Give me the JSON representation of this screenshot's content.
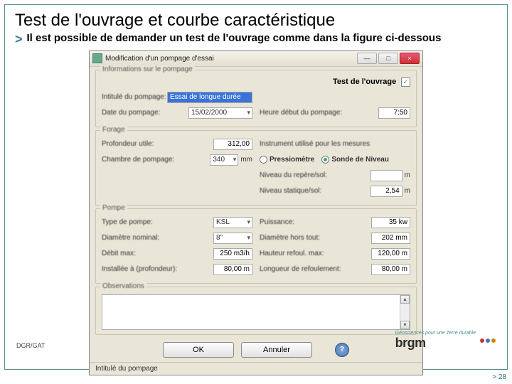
{
  "slide": {
    "title": "Test de l'ouvrage et courbe caractéristique",
    "bullet": "Il est possible de demander un test de l'ouvrage comme dans la figure ci-dessous",
    "footer_left": "DGR/GAT",
    "brgm_tag": "Géosciences pour une Terre durable",
    "brgm_name": "brgm",
    "pagenum": "> 28"
  },
  "dlg": {
    "title": "Modification d'un pompage d'essai",
    "win_min": "—",
    "win_max": "□",
    "win_close": "×",
    "grp_info": "Informations sur le pompage",
    "test_label": "Test de l'ouvrage",
    "test_check": "✓",
    "lbl_intitule": "Intitulé du pompage:",
    "val_intitule": "Essai de longue durée",
    "lbl_date": "Date du pompage:",
    "val_date": "15/02/2000",
    "lbl_heure": "Heure début du pompage:",
    "val_heure": "7:50",
    "grp_forage": "Forage",
    "lbl_prof": "Profondeur utile:",
    "val_prof": "312,00",
    "lbl_cham": "Chambre de pompage:",
    "val_cham": "340",
    "unit_mm": "mm",
    "lbl_instr": "Instrument utilisé pour les mesures",
    "r_pressio": "Pressiomètre",
    "r_sonde": "Sonde de Niveau",
    "lbl_nrepere": "Niveau du repère/sol:",
    "val_nrepere": "",
    "unit_m": "m",
    "lbl_nstatique": "Niveau statique/sol:",
    "val_nstatique": "2,54",
    "grp_pompe": "Pompe",
    "lbl_type": "Type de pompe:",
    "val_type": "KSL",
    "lbl_puiss": "Puissance:",
    "val_puiss": "35 kw",
    "lbl_diamn": "Diamètre nominal:",
    "val_diamn": "8\"",
    "lbl_diamht": "Diamètre hors tout:",
    "val_diamht": "202 mm",
    "lbl_debit": "Débit max:",
    "val_debit": "250 m3/h",
    "lbl_hrefoul": "Hauteur refoul. max:",
    "val_hrefoul": "120,00 m",
    "lbl_inst": "Installée à (profondeur):",
    "val_inst": "80,00 m",
    "lbl_lrefoul": "Longueur de refoulement:",
    "val_lrefoul": "80,00 m",
    "grp_obs": "Observations",
    "btn_ok": "OK",
    "btn_cancel": "Annuler",
    "help": "?",
    "status": "Intitulé du pompage"
  }
}
